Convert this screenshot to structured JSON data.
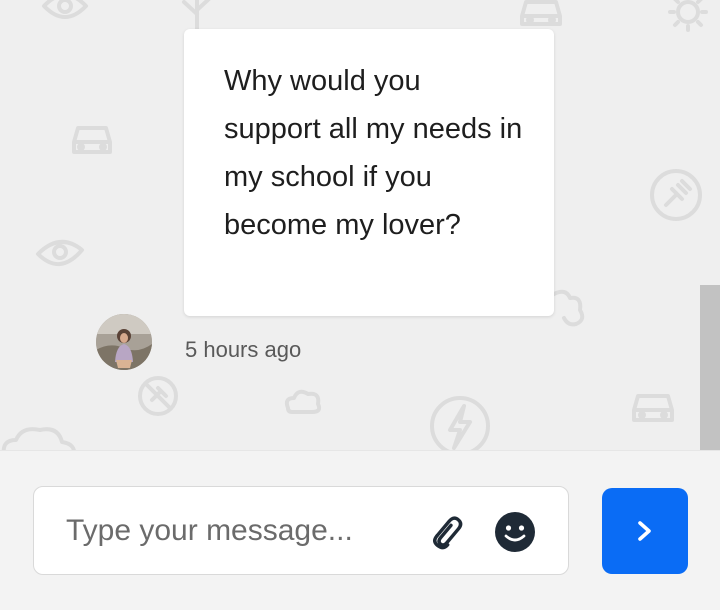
{
  "chat": {
    "message": {
      "text": "Why would you support all my needs in my school if you become my lover?",
      "timestamp": "5 hours ago",
      "sender_avatar_icon": "user-photo-avatar"
    },
    "background_pattern": "doodle-wallpaper"
  },
  "composer": {
    "placeholder": "Type your message...",
    "value": "",
    "attach_icon": "paperclip-icon",
    "emoji_icon": "smiley-icon",
    "send_icon": "chevron-right-icon"
  },
  "colors": {
    "accent": "#0a6cf5",
    "chat_background": "#efefef",
    "bubble": "#ffffff",
    "emoji": "#1f2a36"
  }
}
